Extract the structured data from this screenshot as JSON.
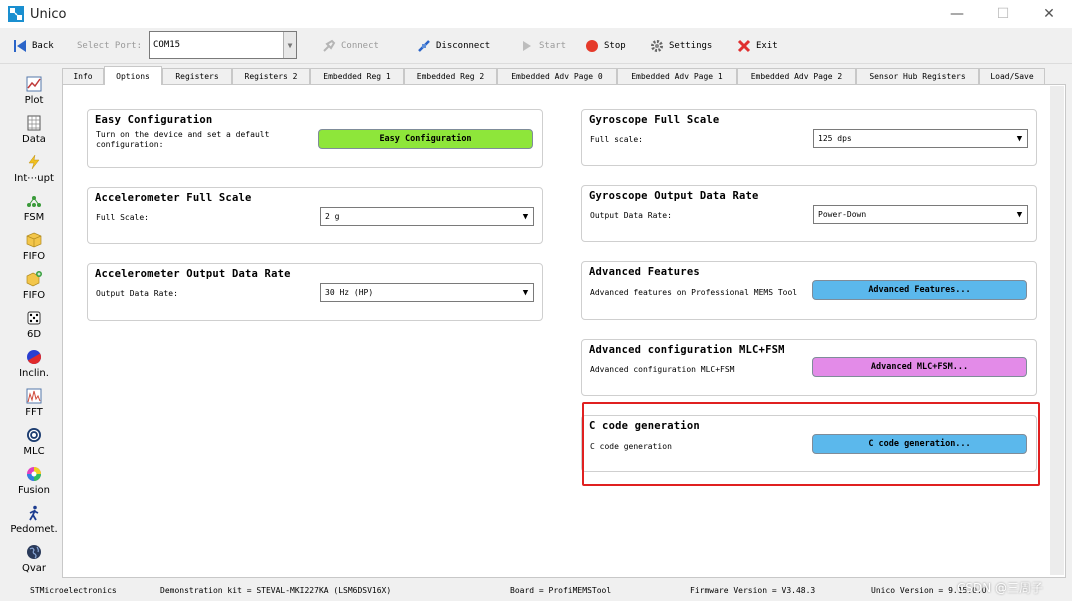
{
  "window": {
    "title": "Unico",
    "minimize": "—",
    "maximize": "☐",
    "close": "✕"
  },
  "toolbar": {
    "back": "Back",
    "select_port_label": "Select Port:",
    "port_value": "COM15",
    "connect": "Connect",
    "disconnect": "Disconnect",
    "start": "Start",
    "stop": "Stop",
    "settings": "Settings",
    "exit": "Exit"
  },
  "sidebar": {
    "items": [
      "Plot",
      "Data",
      "Int⋯upt",
      "FSM",
      "FIFO",
      "FIFO",
      "6D",
      "Inclin.",
      "FFT",
      "MLC",
      "Fusion",
      "Pedomet.",
      "Qvar"
    ]
  },
  "tabs": [
    "Info",
    "Options",
    "Registers",
    "Registers 2",
    "Embedded Reg 1",
    "Embedded Reg 2",
    "Embedded Adv Page 0",
    "Embedded Adv Page 1",
    "Embedded Adv Page 2",
    "Sensor Hub Registers",
    "Load/Save"
  ],
  "panels": {
    "easy": {
      "title": "Easy Configuration",
      "desc_line1": "Turn on the device and set a default",
      "desc_line2": "configuration:",
      "button": "Easy Configuration"
    },
    "acc_fs": {
      "title": "Accelerometer Full Scale",
      "label": "Full Scale:",
      "value": "2 g"
    },
    "acc_odr": {
      "title": "Accelerometer Output Data Rate",
      "label": "Output Data Rate:",
      "value": "30 Hz (HP)"
    },
    "gyro_fs": {
      "title": "Gyroscope Full Scale",
      "label": "Full scale:",
      "value": "125 dps"
    },
    "gyro_odr": {
      "title": "Gyroscope Output Data Rate",
      "label": "Output Data Rate:",
      "value": "Power-Down"
    },
    "adv": {
      "title": "Advanced Features",
      "desc": "Advanced features on Professional MEMS Tool",
      "button": "Advanced Features..."
    },
    "mlc": {
      "title": "Advanced configuration MLC+FSM",
      "desc": "Advanced configuration MLC+FSM",
      "button": "Advanced MLC+FSM..."
    },
    "ccode": {
      "title": "C code generation",
      "desc": "C code generation",
      "button": "C code generation..."
    }
  },
  "status": {
    "company": "STMicroelectronics",
    "kit": "Demonstration kit = STEVAL-MKI227KA (LSM6DSV16X)",
    "board": "Board = ProfiMEMSTool",
    "firmware": "Firmware Version = V3.48.3",
    "unico": "Unico Version = 9.15.0.0",
    "watermark": "CSDN @三周子"
  },
  "colors": {
    "easy_btn": "#8ee63a",
    "blue_btn": "#5bb8ec",
    "pink_btn": "#e38be8",
    "highlight": "#e02020"
  }
}
